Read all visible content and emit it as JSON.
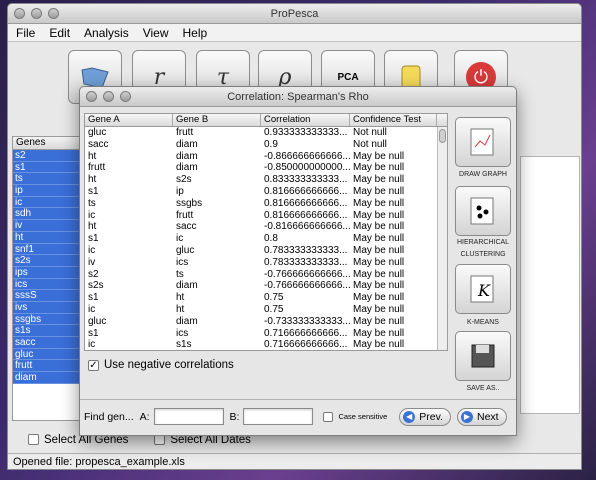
{
  "app": {
    "title": "ProPesca"
  },
  "menu": [
    "File",
    "Edit",
    "Analysis",
    "View",
    "Help"
  ],
  "toolbar": {
    "buttons": [
      {
        "name": "open-icon",
        "glyph": ""
      },
      {
        "name": "r-icon",
        "glyph": "r"
      },
      {
        "name": "tau-icon",
        "glyph": "τ"
      },
      {
        "name": "rho-icon",
        "glyph": "ρ"
      },
      {
        "name": "pca-icon",
        "glyph": "PCA"
      },
      {
        "name": "script-icon",
        "glyph": ""
      },
      {
        "name": "power-icon",
        "glyph": "⏻"
      }
    ]
  },
  "genes_panel": {
    "header": "Genes",
    "items": [
      "s2",
      "s1",
      "ts",
      "ip",
      "ic",
      "sdh",
      "iv",
      "ht",
      "snf1",
      "s2s",
      "ips",
      "ics",
      "sssS",
      "ivs",
      "ssgbs",
      "s1s",
      "sacc",
      "gluc",
      "frutt",
      "diam"
    ]
  },
  "bottom": {
    "select_all_genes": "Select All Genes",
    "select_all_dates": "Select All Dates"
  },
  "status": {
    "text": "Opened file:  propesca_example.xls"
  },
  "dialog": {
    "title": "Correlation: Spearman's Rho",
    "columns": [
      "Gene A",
      "Gene B",
      "Correlation",
      "Confidence Test"
    ],
    "rows": [
      [
        "gluc",
        "frutt",
        "0.933333333333...",
        "Not null"
      ],
      [
        "sacc",
        "diam",
        "0.9",
        "Not null"
      ],
      [
        "ht",
        "diam",
        "-0.866666666666...",
        "May be null"
      ],
      [
        "frutt",
        "diam",
        "-0.850000000000...",
        "May be null"
      ],
      [
        "ht",
        "s2s",
        "0.833333333333...",
        "May be null"
      ],
      [
        "s1",
        "ip",
        "0.816666666666...",
        "May be null"
      ],
      [
        "ts",
        "ssgbs",
        "0.816666666666...",
        "May be null"
      ],
      [
        "ic",
        "frutt",
        "0.816666666666...",
        "May be null"
      ],
      [
        "ht",
        "sacc",
        "-0.816666666666...",
        "May be null"
      ],
      [
        "s1",
        "ic",
        "0.8",
        "May be null"
      ],
      [
        "ic",
        "gluc",
        "0.783333333333...",
        "May be null"
      ],
      [
        "iv",
        "ics",
        "0.783333333333...",
        "May be null"
      ],
      [
        "s2",
        "ts",
        "-0.766666666666...",
        "May be null"
      ],
      [
        "s2s",
        "diam",
        "-0.766666666666...",
        "May be null"
      ],
      [
        "s1",
        "ht",
        "0.75",
        "May be null"
      ],
      [
        "ic",
        "ht",
        "0.75",
        "May be null"
      ],
      [
        "gluc",
        "diam",
        "-0.733333333333...",
        "May be null"
      ],
      [
        "s1",
        "ics",
        "0.716666666666...",
        "May be null"
      ],
      [
        "ic",
        "s1s",
        "0.716666666666...",
        "May be null"
      ]
    ],
    "use_negative": "Use negative correlations",
    "find_label": "Find gen...",
    "a_label": "A:",
    "b_label": "B:",
    "case_sensitive": "Case sensitive",
    "prev": "Prev.",
    "next": "Next",
    "side_buttons": [
      {
        "label": "DRAW GRAPH"
      },
      {
        "label": "HIERARCHICAL CLUSTERING"
      },
      {
        "label": "K-MEANS"
      },
      {
        "label": "SAVE AS.."
      }
    ]
  },
  "colors": {
    "selection": "#3b6fd8",
    "accent": "#3a72d6"
  }
}
